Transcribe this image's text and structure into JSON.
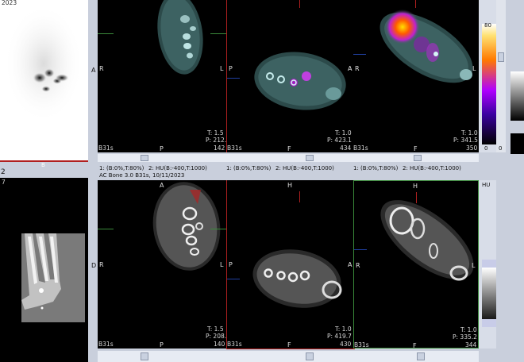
{
  "left_panel": {
    "mip_year": "2023",
    "mip_marker": "B",
    "view2_index": "2",
    "view2_sub": "7"
  },
  "top_row": [
    {
      "tl": "R",
      "tr": "L",
      "t": "T: 1.5",
      "p": "P: 212.9",
      "br": "142",
      "bl": "B31s",
      "bc": "P",
      "ml": "A"
    },
    {
      "tl": "P",
      "tr": "A",
      "t": "T: 1.0",
      "p": "P: 423.1",
      "br": "434",
      "bl": "B31s",
      "bc": "F",
      "ml": ""
    },
    {
      "tl": "R",
      "tr": "L",
      "t": "T: 1.0",
      "p": "P: 341.5",
      "br": "350",
      "bl": "B31s",
      "bc": "F",
      "ml": ""
    }
  ],
  "bottom_row": [
    {
      "tl": "R",
      "tr": "L",
      "tc": "A",
      "t": "T: 1.5",
      "p": "P: 208.9",
      "br": "140",
      "bl": "B31s",
      "bc": "P",
      "ml": "D"
    },
    {
      "tl": "P",
      "tr": "A",
      "tc": "H",
      "t": "T: 1.0",
      "p": "P: 419.7",
      "br": "430",
      "bl": "B31s",
      "bc": "F",
      "ml": ""
    },
    {
      "tl": "R",
      "tr": "L",
      "tc": "H",
      "t": "T: 1.0",
      "p": "P: 335.2",
      "br": "344",
      "bl": "B31s",
      "bc": "F",
      "ml": ""
    }
  ],
  "status": {
    "wl1": "1: (B:0%,T:80%)",
    "wl2": "2: HU(B:-400,T:1000)",
    "wl3": "1: (B:0%,T:80%)",
    "wl4": "2: HU(B:-400,T:1000)",
    "wl5": "1: (B:0%,T:80%)",
    "wl6": "2: HU(B:-400,T:1000)",
    "series": "AC Bone 3.0 B31s, 10/11/2023"
  },
  "colorbar": {
    "top": "80",
    "bottom": "0",
    "right": "0"
  },
  "hu_label": "HU",
  "colors": {
    "pet_hot": "#ff3c00",
    "pet_mid": "#b000ff",
    "crosshair": "#3a8a3a",
    "accent_red": "#b02020"
  }
}
